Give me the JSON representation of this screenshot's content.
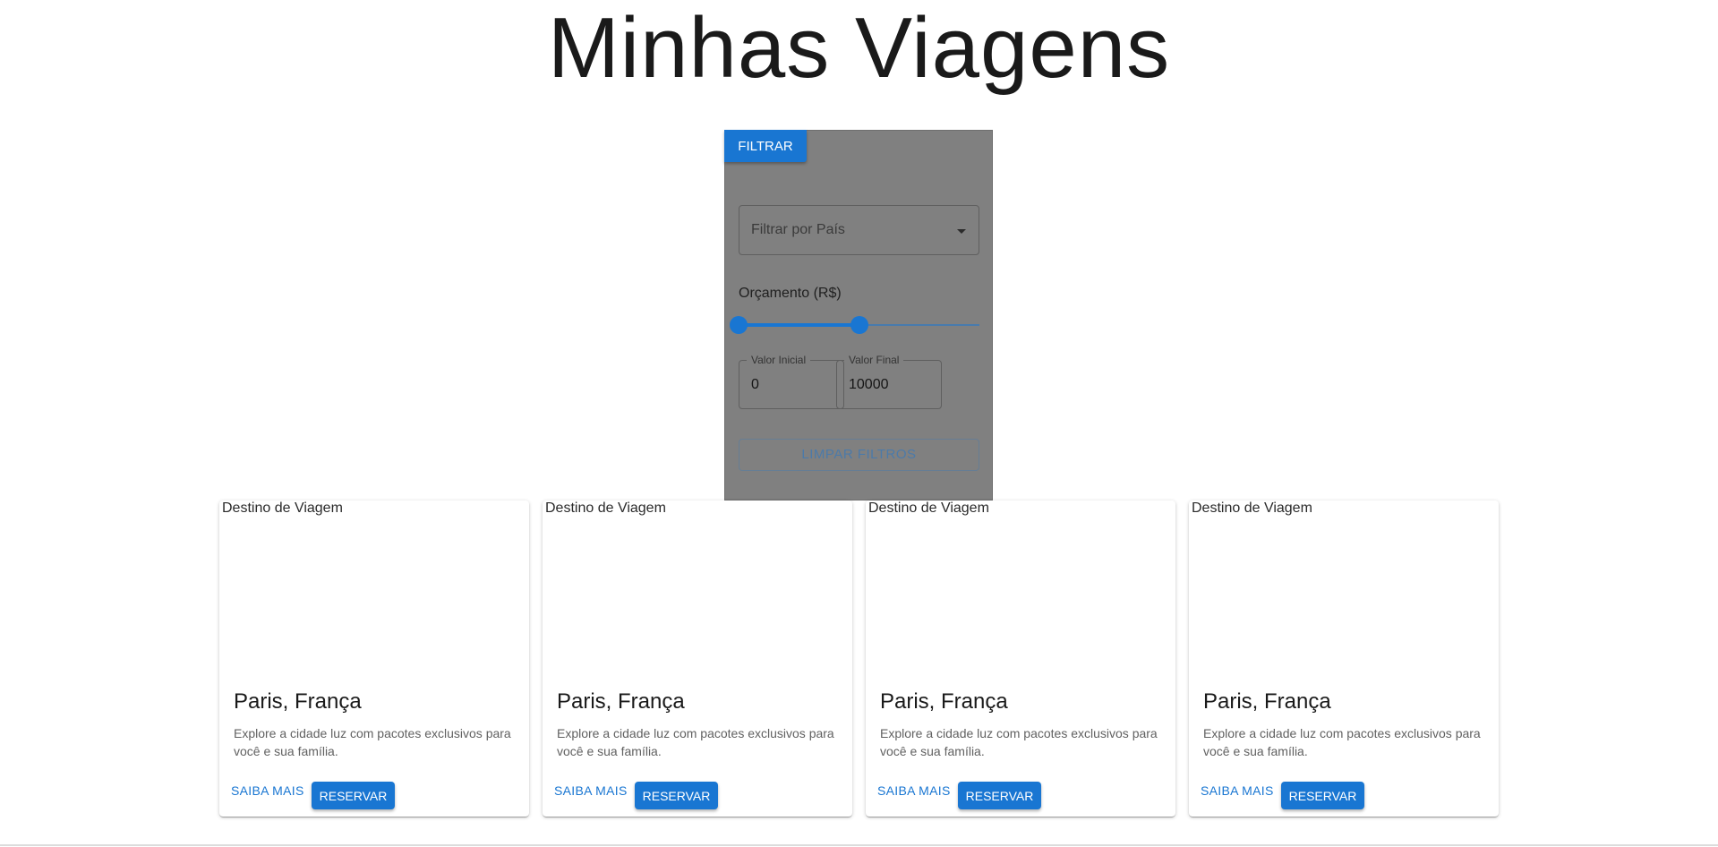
{
  "header": {
    "title": "Minhas Viagens"
  },
  "filters": {
    "toggle_label": "FILTRAR",
    "country_placeholder": "Filtrar por País",
    "budget_label": "Orçamento (R$)",
    "slider": {
      "min": 0,
      "max": 20000,
      "low": 0,
      "high": 10000
    },
    "min_field": {
      "label": "Valor Inicial",
      "value": "0"
    },
    "max_field": {
      "label": "Valor Final",
      "value": "10000"
    },
    "clear_label": "LIMPAR FILTROS"
  },
  "cards": [
    {
      "img_alt": "Destino de Viagem",
      "title": "Paris, França",
      "description": "Explore a cidade luz com pacotes exclusivos para você e sua família.",
      "learn_label": "SAIBA MAIS",
      "reserve_label": "RESERVAR"
    },
    {
      "img_alt": "Destino de Viagem",
      "title": "Paris, França",
      "description": "Explore a cidade luz com pacotes exclusivos para você e sua família.",
      "learn_label": "SAIBA MAIS",
      "reserve_label": "RESERVAR"
    },
    {
      "img_alt": "Destino de Viagem",
      "title": "Paris, França",
      "description": "Explore a cidade luz com pacotes exclusivos para você e sua família.",
      "learn_label": "SAIBA MAIS",
      "reserve_label": "RESERVAR"
    },
    {
      "img_alt": "Destino de Viagem",
      "title": "Paris, França",
      "description": "Explore a cidade luz com pacotes exclusivos para você e sua família.",
      "learn_label": "SAIBA MAIS",
      "reserve_label": "RESERVAR"
    }
  ],
  "colors": {
    "primary": "#1976d2",
    "overlay": "#808080"
  },
  "icons": {
    "select_arrow": "arrow-drop-down-icon",
    "broken_image": "broken-image-icon"
  }
}
